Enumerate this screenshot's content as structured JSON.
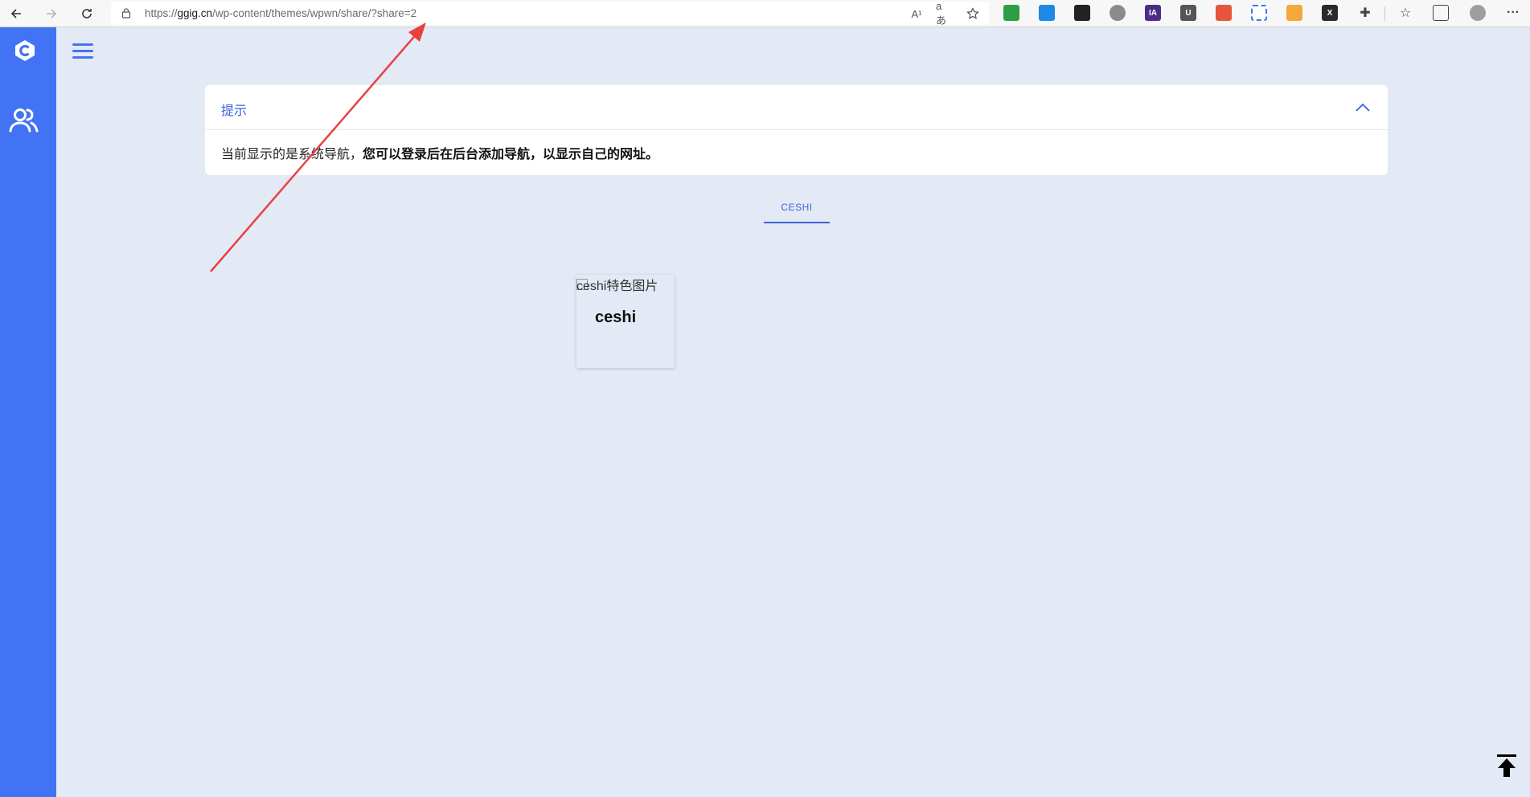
{
  "browser": {
    "url_scheme": "https://",
    "url_host": "ggig.cn",
    "url_path": "/wp-content/themes/wpwn/share/?share=2",
    "read_aloud_icon": "A¹",
    "translate_icon": "aあ",
    "extensions": [
      {
        "name": "ext-1",
        "color": "#2e9e44"
      },
      {
        "name": "ext-2",
        "color": "#1e88e5"
      },
      {
        "name": "ext-3",
        "color": "#222222"
      },
      {
        "name": "ext-4",
        "color": "#8a8a8a"
      },
      {
        "name": "ext-ia",
        "label": "IA",
        "color": "#4b2e83"
      },
      {
        "name": "ext-u",
        "label": "U",
        "color": "#555555"
      },
      {
        "name": "ext-6",
        "color": "#e8553d"
      },
      {
        "name": "ext-7",
        "color": "#3a78f2"
      },
      {
        "name": "ext-8",
        "color": "#f5a83a"
      },
      {
        "name": "ext-x",
        "label": "X",
        "color": "#2a2a2a"
      }
    ]
  },
  "sidebar": {
    "accent": "#4373f5"
  },
  "notice": {
    "title": "提示",
    "text_normal": "当前显示的是系统导航，",
    "text_bold": "您可以登录后在后台添加导航，以显示自己的网址。"
  },
  "tabs": [
    {
      "label": "CESHI",
      "active": true
    }
  ],
  "card": {
    "image_alt": "ceshi特色图片",
    "title": "ceshi"
  }
}
